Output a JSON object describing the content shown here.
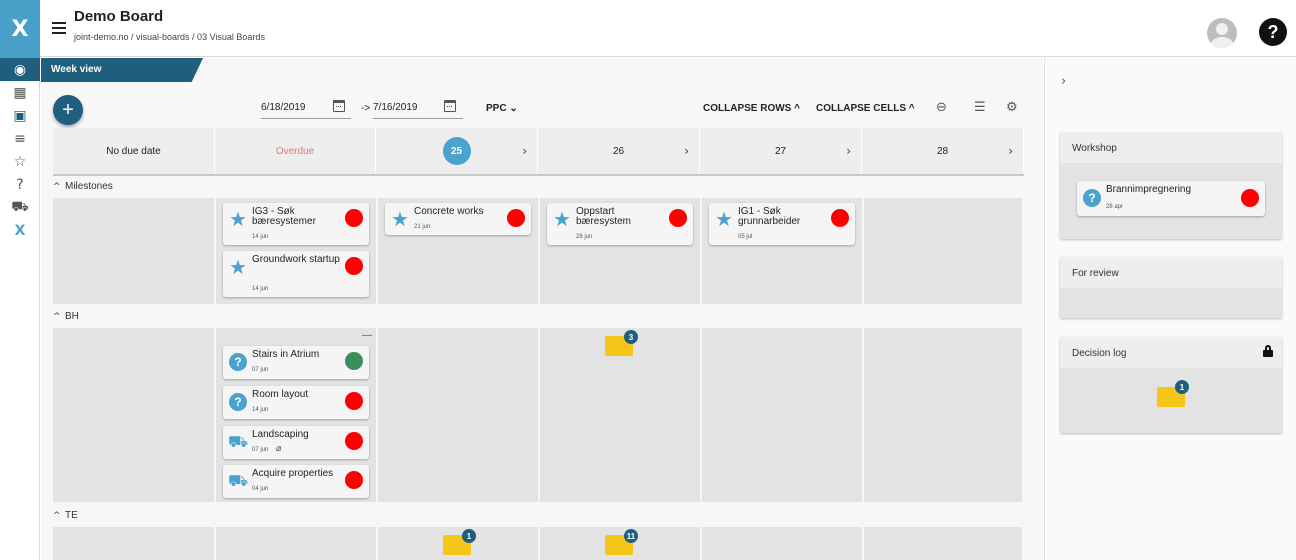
{
  "app": {
    "title": "Demo Board",
    "breadcrumb": "joint-demo.no / visual-boards / 03 Visual Boards"
  },
  "rail": {
    "logo": "X",
    "items": [
      "globe-icon",
      "grid-icon",
      "calendar-icon",
      "list-check-icon",
      "star-icon",
      "question-icon",
      "truck-icon",
      "x-logo-icon"
    ]
  },
  "toolbar": {
    "week_tab": "Week view",
    "add": "+",
    "date_from": "6/18/2019",
    "date_arrow": "->",
    "date_to": "7/16/2019",
    "ppc": "PPC ⌄",
    "collapse_rows": "COLLAPSE ROWS ^",
    "collapse_cells": "COLLAPSE CELLS ^"
  },
  "columns": [
    {
      "label": "No due date"
    },
    {
      "label": "Overdue",
      "color": "#e57373"
    },
    {
      "label": "25",
      "current": true
    },
    {
      "label": "26"
    },
    {
      "label": "27"
    },
    {
      "label": "28"
    }
  ],
  "rows": {
    "milestones": "Milestones",
    "bh": "BH",
    "te": "TE"
  },
  "cards": {
    "m1": {
      "title": "IG3 - Søk bæresystemer",
      "date": "14 jun",
      "status": "#ff0000"
    },
    "m2": {
      "title": "Groundwork startup",
      "date": "14 jun",
      "status": "#ff0000"
    },
    "m3": {
      "title": "Concrete works",
      "date": "21 jun",
      "status": "#ff0000"
    },
    "m4": {
      "title": "Oppstart bæresystem",
      "date": "28 jun",
      "status": "#ff0000"
    },
    "m5": {
      "title": "IG1 - Søk grunnarbeider",
      "date": "05 jul",
      "status": "#ff0000"
    },
    "b1": {
      "title": "Stairs in Atrium",
      "date": "07 jun",
      "status": "#3a8f5c"
    },
    "b2": {
      "title": "Room layout",
      "date": "14 jun",
      "status": "#ff0000"
    },
    "b3": {
      "title": "Landscaping",
      "date": "07 jun",
      "status": "#ff0000"
    },
    "b4": {
      "title": "Acquire properties",
      "date": "04 jun",
      "status": "#ff0000"
    }
  },
  "folders": {
    "bh26": "3",
    "te25": "1",
    "te26": "11"
  },
  "side": {
    "workshop": "Workshop",
    "ws_card": {
      "title": "Brannimpregnering",
      "date": "28 apr",
      "status": "#ff0000"
    },
    "for_review": "For review",
    "decision_log": "Decision log",
    "decision_count": "1"
  }
}
